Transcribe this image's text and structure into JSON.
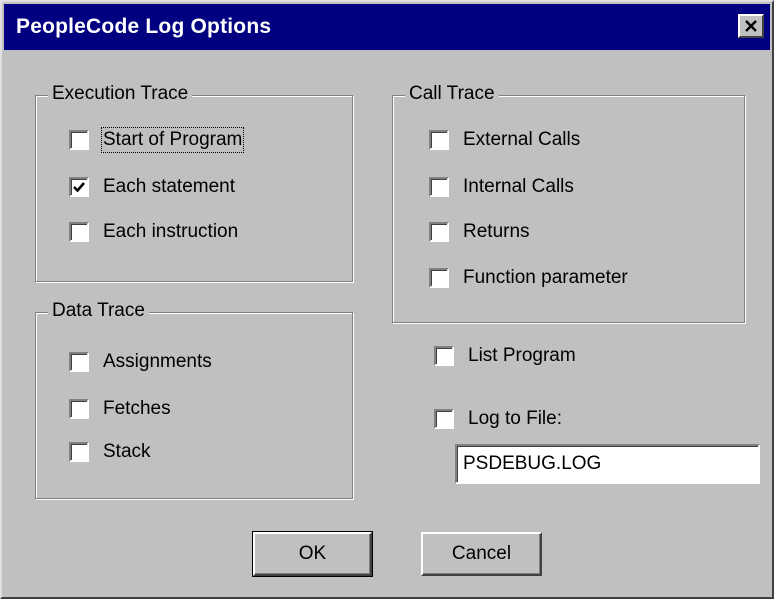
{
  "window": {
    "title": "PeopleCode Log Options",
    "close_icon": "close-icon"
  },
  "execution_trace": {
    "title": "Execution Trace",
    "items": [
      {
        "label": "Start of Program",
        "checked": false
      },
      {
        "label": "Each statement",
        "checked": true
      },
      {
        "label": "Each instruction",
        "checked": false
      }
    ]
  },
  "call_trace": {
    "title": "Call Trace",
    "items": [
      {
        "label": "External Calls",
        "checked": false
      },
      {
        "label": "Internal Calls",
        "checked": false
      },
      {
        "label": "Returns",
        "checked": false
      },
      {
        "label": "Function parameter",
        "checked": false
      }
    ]
  },
  "data_trace": {
    "title": "Data Trace",
    "items": [
      {
        "label": "Assignments",
        "checked": false
      },
      {
        "label": "Fetches",
        "checked": false
      },
      {
        "label": "Stack",
        "checked": false
      }
    ]
  },
  "list_program": {
    "label": "List Program",
    "checked": false
  },
  "log_to_file": {
    "label": "Log to File:",
    "checked": false,
    "filename": "PSDEBUG.LOG"
  },
  "buttons": {
    "ok": "OK",
    "cancel": "Cancel"
  },
  "colors": {
    "titlebar": "#000080",
    "face": "#c0c0c0"
  }
}
